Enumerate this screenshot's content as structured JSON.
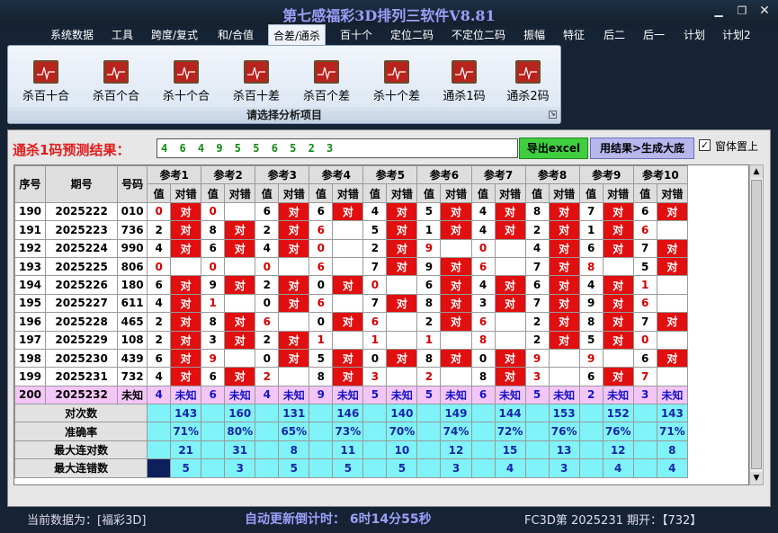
{
  "title": "第七感福彩3D排列三软件V8.81",
  "menu": [
    "系统数据",
    "工具",
    "跨度/复式",
    "和/合值",
    "合差/通杀",
    "百十个",
    "定位二码",
    "不定位二码",
    "振幅",
    "特征",
    "后二",
    "后一",
    "计划",
    "计划2"
  ],
  "active_menu": "合差/通杀",
  "ribbon": {
    "buttons": [
      "杀百十合",
      "杀百个合",
      "杀十个合",
      "杀百十差",
      "杀百个差",
      "杀十个差",
      "通杀1码",
      "通杀2码"
    ],
    "footer": "请选择分析项目"
  },
  "prediction": {
    "label": "通杀1码预测结果：",
    "value": "4 6 4 9 5 5 6 5 2 3",
    "export_button": "导出excel",
    "generate_button": "用结果>生成大底",
    "topmost_label": "窗体置上",
    "topmost_checked": "✓"
  },
  "table": {
    "head": {
      "seq": "序号",
      "period": "期号",
      "number": "号码"
    },
    "refs": [
      "参考1",
      "参考2",
      "参考3",
      "参考4",
      "参考5",
      "参考6",
      "参考7",
      "参考8",
      "参考9",
      "参考10"
    ],
    "sub": [
      "值",
      "对错"
    ],
    "hit_text": "对",
    "rows": [
      {
        "seq": "190",
        "period": "2025222",
        "number": "010",
        "vals": [
          "0",
          "0",
          "6",
          "6",
          "4",
          "5",
          "4",
          "8",
          "7",
          "6"
        ],
        "hits": [
          1,
          0,
          1,
          1,
          1,
          1,
          1,
          1,
          1,
          1
        ],
        "red": [
          1,
          1,
          0,
          0,
          0,
          0,
          0,
          0,
          0,
          0
        ]
      },
      {
        "seq": "191",
        "period": "2025223",
        "number": "736",
        "vals": [
          "2",
          "8",
          "2",
          "6",
          "5",
          "1",
          "4",
          "2",
          "1",
          "6"
        ],
        "hits": [
          1,
          1,
          1,
          0,
          1,
          1,
          1,
          1,
          1,
          0
        ],
        "red": [
          0,
          0,
          0,
          1,
          0,
          0,
          0,
          0,
          0,
          1
        ]
      },
      {
        "seq": "192",
        "period": "2025224",
        "number": "990",
        "vals": [
          "4",
          "6",
          "4",
          "0",
          "2",
          "9",
          "0",
          "4",
          "6",
          "7"
        ],
        "hits": [
          1,
          1,
          1,
          0,
          1,
          0,
          0,
          1,
          1,
          1
        ],
        "red": [
          0,
          0,
          0,
          1,
          0,
          1,
          1,
          0,
          0,
          0
        ]
      },
      {
        "seq": "193",
        "period": "2025225",
        "number": "806",
        "vals": [
          "0",
          "0",
          "0",
          "6",
          "7",
          "9",
          "6",
          "7",
          "8",
          "5"
        ],
        "hits": [
          0,
          0,
          0,
          0,
          1,
          1,
          0,
          1,
          0,
          1
        ],
        "red": [
          1,
          1,
          1,
          1,
          0,
          0,
          1,
          0,
          1,
          0
        ]
      },
      {
        "seq": "194",
        "period": "2025226",
        "number": "180",
        "vals": [
          "6",
          "9",
          "2",
          "0",
          "0",
          "6",
          "4",
          "6",
          "4",
          "1"
        ],
        "hits": [
          1,
          1,
          1,
          1,
          0,
          1,
          1,
          1,
          1,
          0
        ],
        "red": [
          0,
          0,
          0,
          0,
          1,
          0,
          0,
          0,
          0,
          1
        ]
      },
      {
        "seq": "195",
        "period": "2025227",
        "number": "611",
        "vals": [
          "4",
          "1",
          "0",
          "6",
          "7",
          "8",
          "3",
          "7",
          "9",
          "6"
        ],
        "hits": [
          1,
          0,
          1,
          0,
          1,
          1,
          1,
          1,
          1,
          0
        ],
        "red": [
          0,
          1,
          0,
          1,
          0,
          0,
          0,
          0,
          0,
          1
        ]
      },
      {
        "seq": "196",
        "period": "2025228",
        "number": "465",
        "vals": [
          "2",
          "8",
          "6",
          "0",
          "6",
          "2",
          "6",
          "2",
          "8",
          "7"
        ],
        "hits": [
          1,
          1,
          0,
          1,
          0,
          1,
          0,
          1,
          1,
          1
        ],
        "red": [
          0,
          0,
          1,
          0,
          1,
          0,
          1,
          0,
          0,
          0
        ]
      },
      {
        "seq": "197",
        "period": "2025229",
        "number": "108",
        "vals": [
          "2",
          "3",
          "2",
          "1",
          "1",
          "1",
          "8",
          "2",
          "5",
          "0"
        ],
        "hits": [
          1,
          1,
          1,
          0,
          0,
          0,
          0,
          1,
          1,
          0
        ],
        "red": [
          0,
          0,
          0,
          1,
          1,
          1,
          1,
          0,
          0,
          1
        ]
      },
      {
        "seq": "198",
        "period": "2025230",
        "number": "439",
        "vals": [
          "6",
          "9",
          "0",
          "5",
          "0",
          "8",
          "0",
          "9",
          "9",
          "6"
        ],
        "hits": [
          1,
          0,
          1,
          1,
          1,
          1,
          1,
          0,
          0,
          1
        ],
        "red": [
          0,
          1,
          0,
          0,
          0,
          0,
          0,
          1,
          1,
          0
        ]
      },
      {
        "seq": "199",
        "period": "2025231",
        "number": "732",
        "vals": [
          "4",
          "6",
          "2",
          "8",
          "3",
          "2",
          "8",
          "3",
          "6",
          "7"
        ],
        "hits": [
          1,
          1,
          0,
          1,
          0,
          0,
          1,
          0,
          1,
          0
        ],
        "red": [
          0,
          0,
          1,
          0,
          1,
          1,
          0,
          1,
          0,
          1
        ]
      }
    ],
    "pending_row": {
      "seq": "200",
      "period": "2025232",
      "number": "未知",
      "vals": [
        "4",
        "6",
        "4",
        "9",
        "5",
        "5",
        "6",
        "5",
        "2",
        "3"
      ],
      "text": "未知"
    },
    "stats": [
      {
        "label": "对次数",
        "vals": [
          "143",
          "160",
          "131",
          "146",
          "140",
          "149",
          "144",
          "153",
          "152",
          "143"
        ]
      },
      {
        "label": "准确率",
        "vals": [
          "71%",
          "80%",
          "65%",
          "73%",
          "70%",
          "74%",
          "72%",
          "76%",
          "76%",
          "71%"
        ]
      },
      {
        "label": "最大连对数",
        "vals": [
          "21",
          "31",
          "8",
          "11",
          "10",
          "12",
          "15",
          "13",
          "12",
          "8"
        ]
      },
      {
        "label": "最大连错数",
        "vals": [
          "5",
          "3",
          "5",
          "5",
          "5",
          "3",
          "4",
          "3",
          "4",
          "4"
        ]
      }
    ]
  },
  "status": {
    "source": "当前数据为：[福彩3D]",
    "countdown": "自动更新倒计时：  6时14分55秒",
    "draw": "FC3D第 2025231 期开：【732】"
  },
  "colors": {
    "hit": "#e10f0f",
    "pending": "#f4c6f8",
    "stats": "#7ff3f7",
    "title": "#9b9ff8",
    "red_text": "#e01b1b"
  }
}
